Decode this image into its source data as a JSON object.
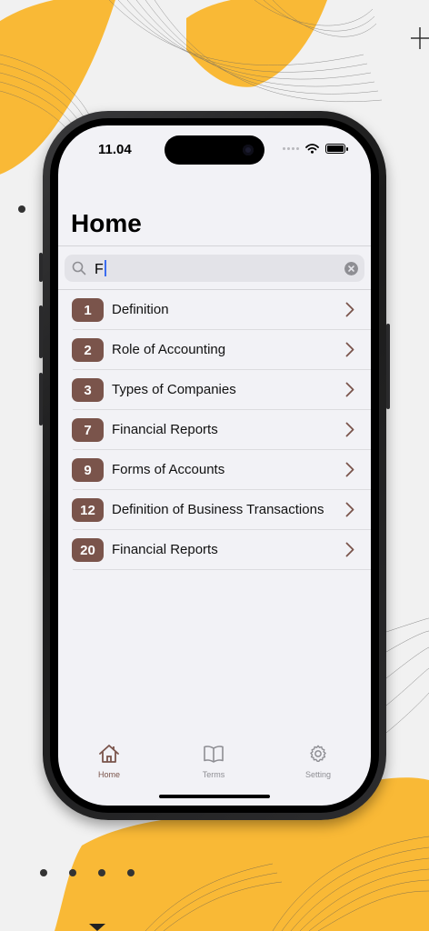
{
  "status": {
    "time": "11.04"
  },
  "header": {
    "title": "Home"
  },
  "search": {
    "value": "F",
    "placeholder": ""
  },
  "list": {
    "items": [
      {
        "number": "1",
        "label": "Definition"
      },
      {
        "number": "2",
        "label": "Role of Accounting"
      },
      {
        "number": "3",
        "label": "Types of Companies"
      },
      {
        "number": "7",
        "label": "Financial Reports"
      },
      {
        "number": "9",
        "label": "Forms of Accounts"
      },
      {
        "number": "12",
        "label": "Definition of Business Transactions"
      },
      {
        "number": "20",
        "label": "Financial Reports"
      }
    ]
  },
  "tabbar": {
    "tabs": [
      {
        "label": "Home",
        "icon": "house-icon",
        "active": true
      },
      {
        "label": "Terms",
        "icon": "book-icon",
        "active": false
      },
      {
        "label": "Setting",
        "icon": "gear-icon",
        "active": false
      }
    ]
  },
  "colors": {
    "accent": "#7a544b",
    "background_orange": "#f9b936",
    "screen_bg": "#f2f2f6"
  }
}
